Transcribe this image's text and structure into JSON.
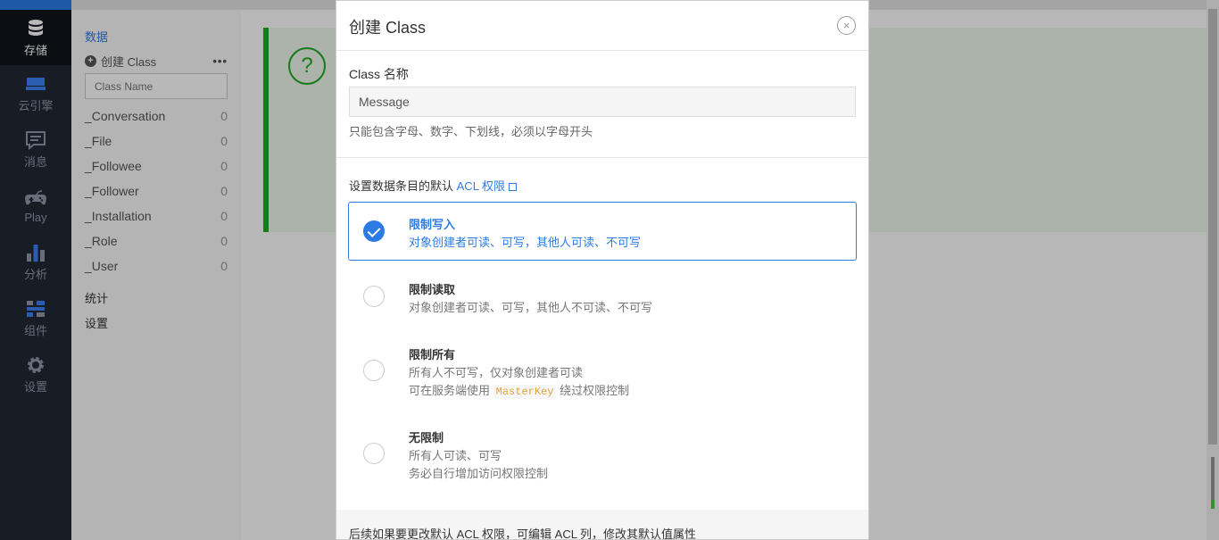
{
  "nav": {
    "items": [
      {
        "label": "存储",
        "icon": "database-icon",
        "active": true
      },
      {
        "label": "云引擎",
        "icon": "cloud-engine-icon"
      },
      {
        "label": "消息",
        "icon": "message-icon"
      },
      {
        "label": "Play",
        "icon": "gamepad-icon"
      },
      {
        "label": "分析",
        "icon": "bar-chart-icon"
      },
      {
        "label": "组件",
        "icon": "components-icon"
      },
      {
        "label": "设置",
        "icon": "gear-icon"
      }
    ]
  },
  "sidebar": {
    "section_data": "数据",
    "create_class": "创建 Class",
    "more": "•••",
    "search_placeholder": "Class Name",
    "classes": [
      {
        "name": "_Conversation",
        "count": "0"
      },
      {
        "name": "_File",
        "count": "0"
      },
      {
        "name": "_Followee",
        "count": "0"
      },
      {
        "name": "_Follower",
        "count": "0"
      },
      {
        "name": "_Installation",
        "count": "0"
      },
      {
        "name": "_Role",
        "count": "0"
      },
      {
        "name": "_User",
        "count": "0"
      }
    ],
    "stats": "统计",
    "settings": "设置"
  },
  "banner": {
    "icon_char": "?"
  },
  "modal": {
    "title": "创建 Class",
    "close": "×",
    "name_label": "Class 名称",
    "name_value": "Message",
    "name_hint": "只能包含字母、数字、下划线，必须以字母开头",
    "acl_label": "设置数据条目的默认",
    "acl_link": "ACL 权限",
    "options": [
      {
        "title": "限制写入",
        "desc1": "对象创建者可读、可写，其他人可读、不可写",
        "selected": true
      },
      {
        "title": "限制读取",
        "desc1": "对象创建者可读、可写，其他人不可读、不可写"
      },
      {
        "title": "限制所有",
        "desc1": "所有人不可写，仅对象创建者可读",
        "desc2_pre": "可在服务端使用",
        "desc2_code": "MasterKey",
        "desc2_post": "绕过权限控制"
      },
      {
        "title": "无限制",
        "desc1": "所有人可读、可写",
        "desc2": "务必自行增加访问权限控制"
      }
    ],
    "footer": "后续如果要更改默认 ACL 权限，可编辑 ACL 列，修改其默认值属性"
  },
  "colors": {
    "accent": "#2c7be5",
    "nav_bg": "#222733",
    "success": "#22aa22",
    "code": "#e8a33b"
  }
}
